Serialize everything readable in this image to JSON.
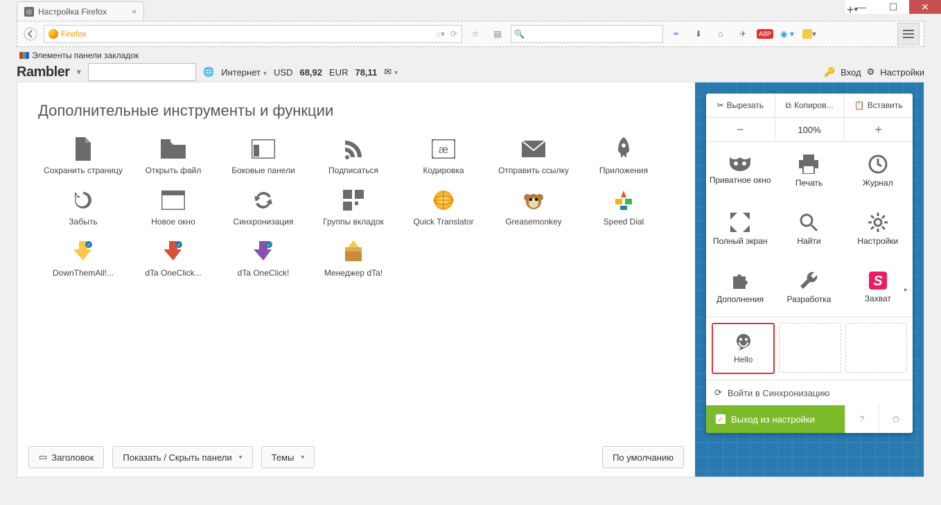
{
  "window": {
    "tab_title": "Настройка Firefox"
  },
  "urlbar": {
    "text": "Firefox"
  },
  "bookmarks": {
    "label": "Элементы панели закладок"
  },
  "rambler": {
    "logo": "Rambler",
    "internet": "Интернет",
    "usd_label": "USD",
    "usd": "68,92",
    "eur_label": "EUR",
    "eur": "78,11",
    "login": "Вход",
    "settings": "Настройки"
  },
  "page": {
    "title": "Дополнительные инструменты и функции",
    "tools": [
      {
        "label": "Сохранить страницу",
        "icon": "file"
      },
      {
        "label": "Открыть файл",
        "icon": "folder"
      },
      {
        "label": "Боковые панели",
        "icon": "sidepanel"
      },
      {
        "label": "Подписаться",
        "icon": "rss"
      },
      {
        "label": "Кодировка",
        "icon": "encoding"
      },
      {
        "label": "Отправить ссылку",
        "icon": "mail"
      },
      {
        "label": "Приложения",
        "icon": "rocket"
      },
      {
        "label": "Забыть",
        "icon": "forget"
      },
      {
        "label": "Новое окно",
        "icon": "window"
      },
      {
        "label": "Синхронизация",
        "icon": "sync"
      },
      {
        "label": "Группы вкладок",
        "icon": "tabgroups"
      },
      {
        "label": "Quick Translator",
        "icon": "globe"
      },
      {
        "label": "Greasemonkey",
        "icon": "monkey"
      },
      {
        "label": "Speed Dial",
        "icon": "speeddial"
      },
      {
        "label": "DownThemAll!...",
        "icon": "dta-yellow"
      },
      {
        "label": "dTa OneClick...",
        "icon": "dta-red"
      },
      {
        "label": "dTa OneClick!",
        "icon": "dta-purple"
      },
      {
        "label": "Менеджер dTa!",
        "icon": "dta-box"
      }
    ],
    "footer": {
      "header_btn": "Заголовок",
      "panels_btn": "Показать / Скрыть панели",
      "themes_btn": "Темы",
      "default_btn": "По умолчанию"
    }
  },
  "panel": {
    "edit": {
      "cut": "Вырезать",
      "copy": "Копиров...",
      "paste": "Вставить"
    },
    "zoom": {
      "value": "100%"
    },
    "grid": [
      {
        "label": "Приватное окно",
        "icon": "mask"
      },
      {
        "label": "Печать",
        "icon": "print"
      },
      {
        "label": "Журнал",
        "icon": "clock"
      },
      {
        "label": "Полный экран",
        "icon": "fullscreen"
      },
      {
        "label": "Найти",
        "icon": "search"
      },
      {
        "label": "Настройки",
        "icon": "gear"
      },
      {
        "label": "Дополнения",
        "icon": "puzzle"
      },
      {
        "label": "Разработка",
        "icon": "wrench"
      },
      {
        "label": "Захват",
        "icon": "capture"
      }
    ],
    "drop": [
      {
        "label": "Hello",
        "selected": true
      },
      {
        "label": ""
      },
      {
        "label": ""
      }
    ],
    "sync": "Войти в Синхронизацию",
    "exit": "Выход из настройки"
  }
}
